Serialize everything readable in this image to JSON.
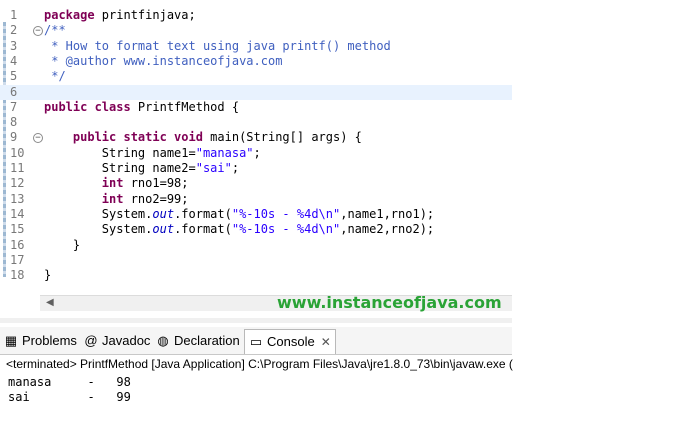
{
  "editor": {
    "lines": [
      {
        "num": "1",
        "fold": "",
        "segments": [
          {
            "t": "package printfinjava;",
            "c": "kw-pkg"
          }
        ]
      },
      {
        "num": "2",
        "fold": "⊖",
        "segments": [
          {
            "t": "/**",
            "c": "cm"
          }
        ]
      },
      {
        "num": "3",
        "fold": "",
        "segments": [
          {
            "t": " * How to format text using java printf() method",
            "c": "cm"
          }
        ]
      },
      {
        "num": "4",
        "fold": "",
        "segments": [
          {
            "t": " * @author www.instanceofjava.com",
            "c": "cm"
          }
        ]
      },
      {
        "num": "5",
        "fold": "",
        "segments": [
          {
            "t": " */",
            "c": "cm"
          }
        ]
      },
      {
        "num": "6",
        "fold": "",
        "segments": []
      },
      {
        "num": "7",
        "fold": "",
        "segments": [
          {
            "t": "public class ",
            "c": "kw"
          },
          {
            "t": "PrintfMethod {",
            "c": ""
          }
        ]
      },
      {
        "num": "8",
        "fold": "",
        "segments": []
      },
      {
        "num": "9",
        "fold": "⊖",
        "segments": [
          {
            "t": "    public static void ",
            "c": "kw"
          },
          {
            "t": "main(String[] args) {",
            "c": ""
          }
        ]
      },
      {
        "num": "10",
        "fold": "",
        "segments": [
          {
            "t": "        String name1=",
            "c": ""
          },
          {
            "t": "\"manasa\"",
            "c": "str"
          },
          {
            "t": ";",
            "c": ""
          }
        ]
      },
      {
        "num": "11",
        "fold": "",
        "segments": [
          {
            "t": "        String name2=",
            "c": ""
          },
          {
            "t": "\"sai\"",
            "c": "str"
          },
          {
            "t": ";",
            "c": ""
          }
        ]
      },
      {
        "num": "12",
        "fold": "",
        "segments": [
          {
            "t": "        int ",
            "c": "kw"
          },
          {
            "t": "rno1=98;",
            "c": ""
          }
        ]
      },
      {
        "num": "13",
        "fold": "",
        "segments": [
          {
            "t": "        int ",
            "c": "kw"
          },
          {
            "t": "rno2=99;",
            "c": ""
          }
        ]
      },
      {
        "num": "14",
        "fold": "",
        "segments": [
          {
            "t": "        System.",
            "c": ""
          },
          {
            "t": "out",
            "c": "it"
          },
          {
            "t": ".format(",
            "c": ""
          },
          {
            "t": "\"%-10s - %4d\\n\"",
            "c": "str"
          },
          {
            "t": ",name1,rno1);",
            "c": ""
          }
        ]
      },
      {
        "num": "15",
        "fold": "",
        "segments": [
          {
            "t": "        System.",
            "c": ""
          },
          {
            "t": "out",
            "c": "it"
          },
          {
            "t": ".format(",
            "c": ""
          },
          {
            "t": "\"%-10s - %4d\\n\"",
            "c": "str"
          },
          {
            "t": ",name2,rno2);",
            "c": ""
          }
        ]
      },
      {
        "num": "16",
        "fold": "",
        "segments": [
          {
            "t": "    }",
            "c": ""
          }
        ]
      },
      {
        "num": "17",
        "fold": "",
        "segments": []
      },
      {
        "num": "18",
        "fold": "",
        "segments": [
          {
            "t": "}",
            "c": ""
          }
        ]
      }
    ],
    "current_line": 6
  },
  "watermark": "www.instanceofjava.com",
  "tabs": [
    {
      "label": "Problems",
      "icon": "problems-icon",
      "glyph": "▦"
    },
    {
      "label": "Javadoc",
      "icon": "javadoc-icon",
      "glyph": "@"
    },
    {
      "label": "Declaration",
      "icon": "declaration-icon",
      "glyph": "◍"
    },
    {
      "label": "Console",
      "icon": "console-icon",
      "glyph": "▭",
      "active": true
    }
  ],
  "console": {
    "terminated": "<terminated> PrintfMethod [Java Application] C:\\Program Files\\Java\\jre1.8.0_73\\bin\\javaw.exe (",
    "output": [
      "manasa     -   98",
      "sai        -   99"
    ]
  }
}
